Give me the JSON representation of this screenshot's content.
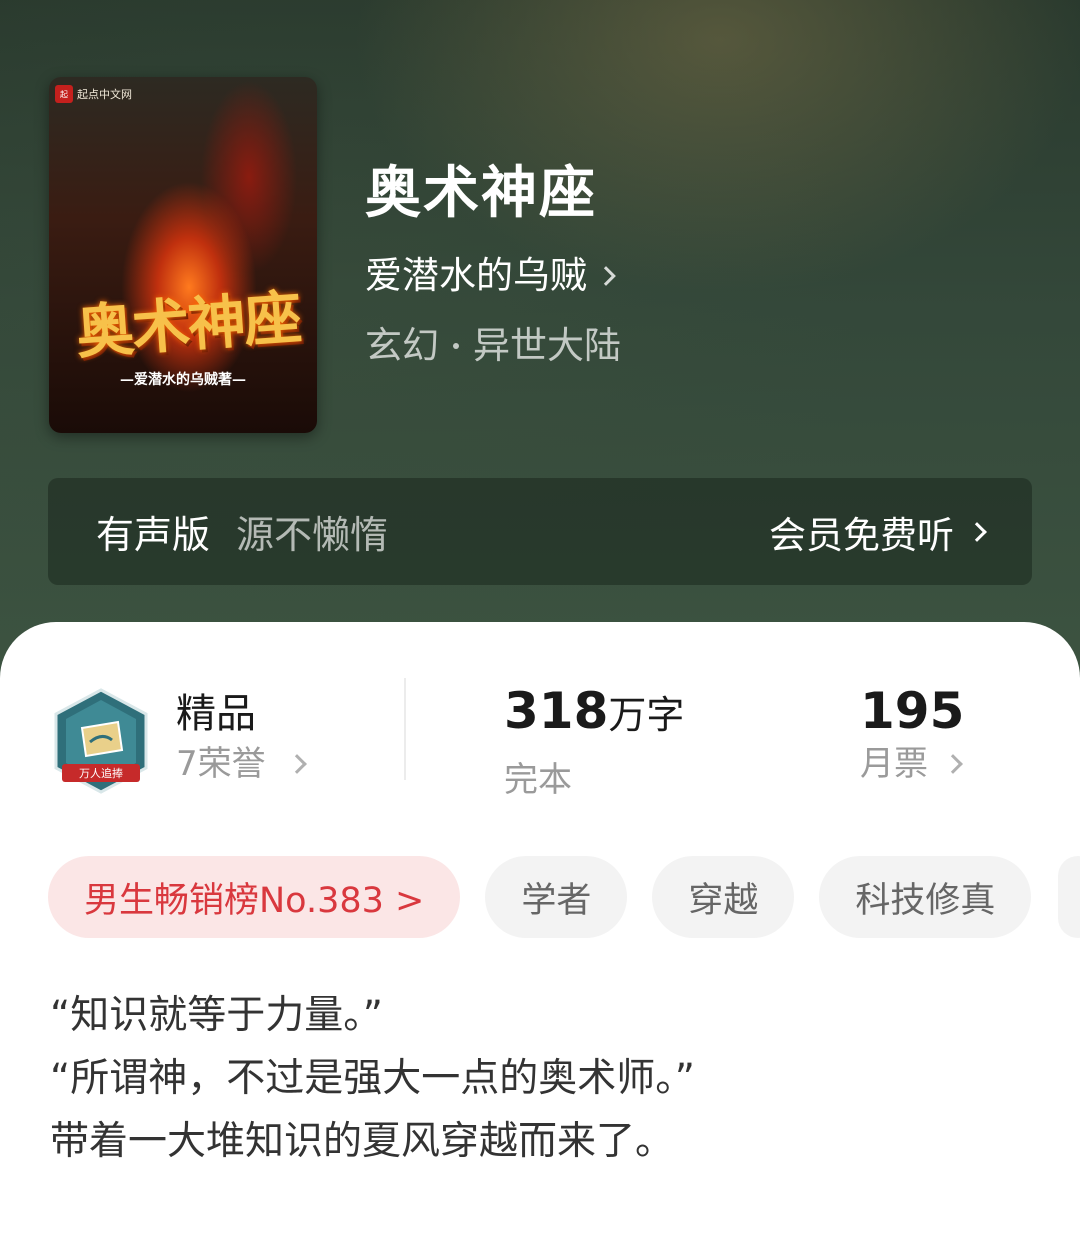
{
  "book": {
    "cover": {
      "publisher_logo": "起点中文网",
      "title_art": "奥术神座",
      "author_line": "—爱潜水的乌贼著—"
    },
    "title": "奥术神座",
    "author": "爱潜水的乌贼",
    "genre_main": "玄幻",
    "genre_sub": "异世大陆"
  },
  "audio": {
    "label": "有声版",
    "narrator": "源不懒惰",
    "cta": "会员免费听"
  },
  "stats": {
    "quality_title": "精品",
    "honors": "7荣誉",
    "badge_text": "万人追捧",
    "word_count": "318",
    "word_unit": "万字",
    "status": "完本",
    "monthly_votes": "195",
    "monthly_votes_label": "月票"
  },
  "tags": {
    "rank": "男生畅销榜No.383 >",
    "items": [
      "学者",
      "穿越",
      "科技修真"
    ]
  },
  "synopsis": {
    "line1": "“知识就等于力量。”",
    "line2": "“所谓神，不过是强大一点的奥术师。”",
    "line3": "带着一大堆知识的夏风穿越而来了。"
  },
  "colors": {
    "hero_bg": "#34483a",
    "rank_tag_bg": "#fbe6e6",
    "rank_tag_text": "#d9383e",
    "tag_bg": "#f3f3f3"
  }
}
